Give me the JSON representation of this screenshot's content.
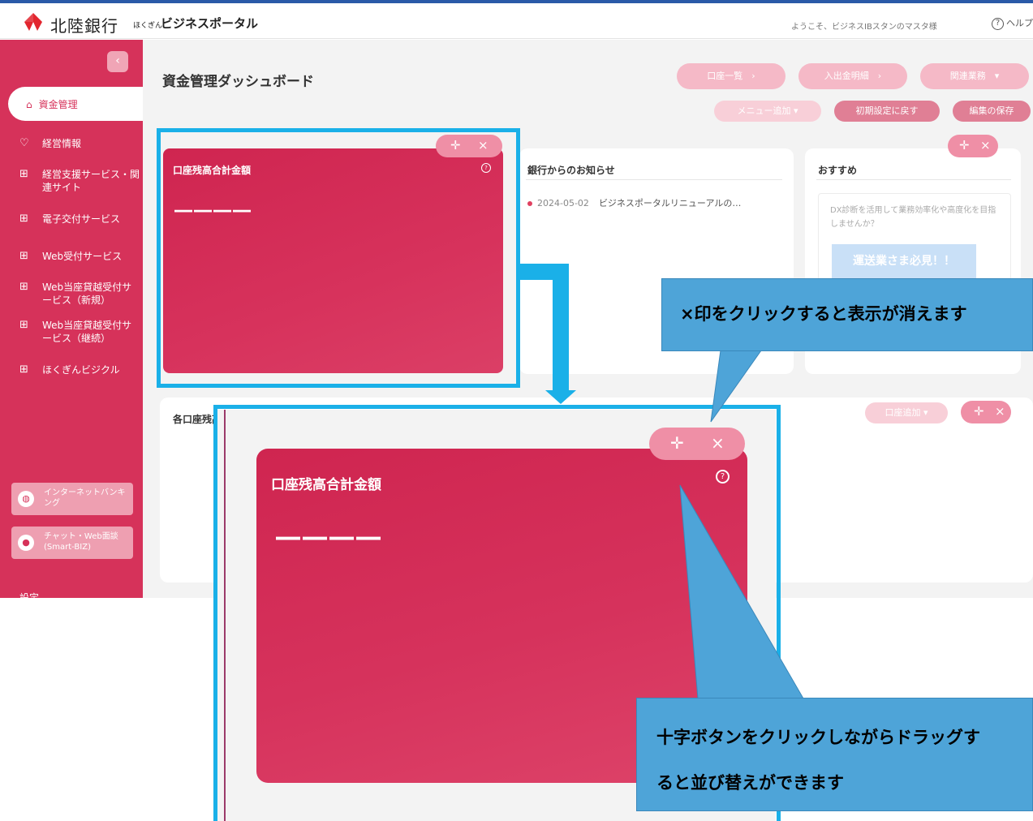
{
  "header": {
    "brand_name": "北陸銀行",
    "brand_small": "ほくぎん",
    "brand_portal": "ビジネスポータル",
    "welcome": "ようこそ、ビジネスIBスタンのマスタ様",
    "help_label": "ヘルプ"
  },
  "sidebar": {
    "collapse_icon": "‹",
    "active_item": "資金管理",
    "items": [
      {
        "label": "経営情報",
        "icon": "lightbulb-icon"
      },
      {
        "label": "経営支援サービス・関連サイト",
        "icon": "grid-icon"
      },
      {
        "label": "電子交付サービス",
        "icon": "grid-icon"
      },
      {
        "label": "Web受付サービス",
        "icon": "grid-icon"
      },
      {
        "label": "Web当座貸越受付サービス（新規）",
        "icon": "grid-icon"
      },
      {
        "label": "Web当座貸越受付サービス（継続）",
        "icon": "grid-icon"
      },
      {
        "label": "ほくぎんビジクル",
        "icon": "grid-icon"
      }
    ],
    "internet_banking": "インターネットバンキング",
    "chat_web": "チャット・Web面談(Smart-BIZ)",
    "settings_partial": "設定"
  },
  "main": {
    "title": "資金管理ダッシュボード",
    "buttons": {
      "account_list": "口座一覧　›",
      "deposit_withdrawal": "入出金明細　›",
      "related_business": "関連業務　▾",
      "add_menu": "メニュー追加 ▾",
      "reset_initial": "初期設定に戻す",
      "save_edit": "編集の保存",
      "add_account": "口座追加 ▾"
    },
    "balance_card": {
      "title": "口座残高合計金額",
      "value": "――――"
    },
    "notices": {
      "title": "銀行からのお知らせ",
      "items": [
        {
          "date": "2024-05-02",
          "text": "ビジネスポータルリニューアルの…"
        }
      ]
    },
    "recommend": {
      "title": "おすすめ",
      "text": "DX診断を活用して業務効率化や高度化を目指しませんか？",
      "banner": "運送業さま必見！！"
    },
    "accounts_panel": {
      "title": "各口座残高"
    }
  },
  "controls": {
    "move_icon": "✛",
    "close_icon": "×"
  },
  "callouts": {
    "close_hint": "×印をクリックすると表示が消えます",
    "drag_hint_line1": "十字ボタンをクリックしながらドラッグす",
    "drag_hint_line2": "ると並び替えができます"
  },
  "colors": {
    "brand": "#d6325a",
    "callout": "#4ea4d8",
    "frame": "#1ab0e8"
  }
}
